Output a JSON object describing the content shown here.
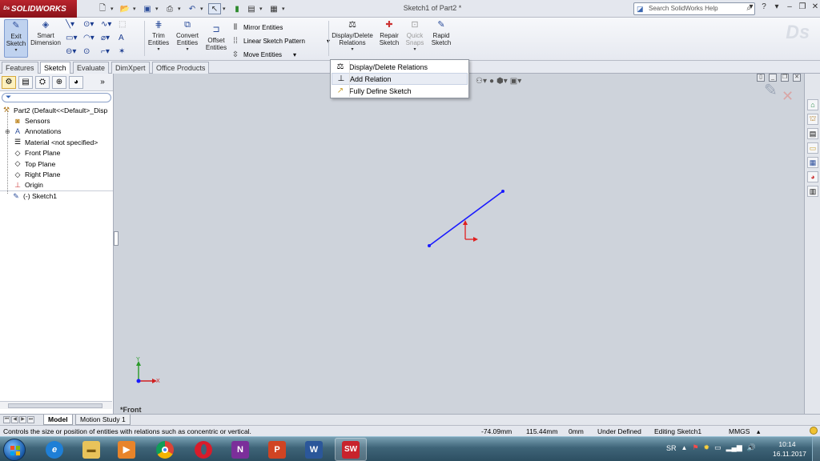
{
  "app": {
    "logo": "SOLIDWORKS",
    "doc_title": "Sketch1 of Part2 *",
    "help_placeholder": "Search SolidWorks Help"
  },
  "ribbon": {
    "exit_sketch": "Exit Sketch",
    "smart_dimension": "Smart Dimension",
    "trim_entities": "Trim Entities",
    "convert_entities": "Convert Entities",
    "offset_entities": "Offset Entities",
    "mirror_entities": "Mirror Entities",
    "linear_sketch_pattern": "Linear Sketch Pattern",
    "move_entities": "Move Entities",
    "display_delete_relations": "Display/Delete Relations",
    "repair_sketch": "Repair Sketch",
    "quick_snaps": "Quick Snaps",
    "rapid_sketch": "Rapid Sketch"
  },
  "tabs": [
    "Features",
    "Sketch",
    "Evaluate",
    "DimXpert",
    "Office Products"
  ],
  "active_tab": "Sketch",
  "dropdown": {
    "items": [
      "Display/Delete Relations",
      "Add Relation",
      "Fully Define Sketch"
    ],
    "highlighted": "Add Relation"
  },
  "tree": {
    "root": "Part2  (Default<<Default>_Disp",
    "items": [
      "Sensors",
      "Annotations",
      "Material <not specified>",
      "Front Plane",
      "Top Plane",
      "Right Plane",
      "Origin",
      "(-) Sketch1"
    ]
  },
  "viewport": {
    "view_name": "*Front",
    "axis_x": "X",
    "axis_y": "Y"
  },
  "bottom_tabs": [
    "Model",
    "Motion Study 1"
  ],
  "status": {
    "message": "Controls the size or position of entities with relations such as concentric or vertical.",
    "x": "-74.09mm",
    "y": "115.44mm",
    "z": "0mm",
    "state": "Under Defined",
    "mode": "Editing Sketch1",
    "units": "MMGS"
  },
  "taskbar": {
    "apps": [
      "Internet Explorer",
      "File Explorer",
      "Media Player",
      "Chrome",
      "Opera",
      "OneNote",
      "PowerPoint",
      "Word",
      "SolidWorks"
    ],
    "lang": "SR",
    "time": "10:14",
    "date": "16.11.2017"
  },
  "colors": {
    "sketch_line": "#1a1aff",
    "origin_arrow": "#e02020",
    "viewport_bg": "#ced3db",
    "logo_bg": "#b8242d"
  }
}
